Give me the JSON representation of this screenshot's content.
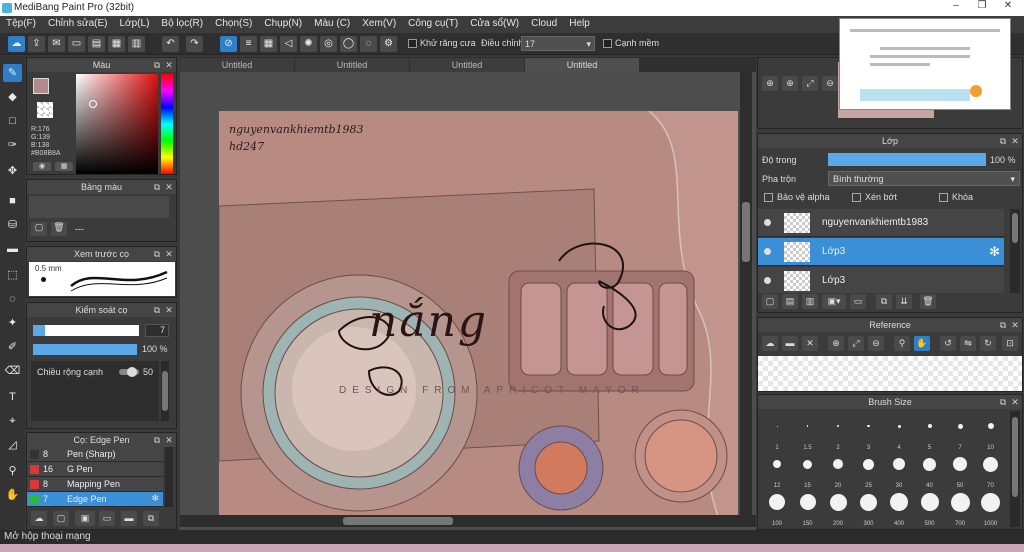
{
  "window": {
    "title": "MediBang Paint Pro (32bit)"
  },
  "menu": [
    "Tệp(F)",
    "Chỉnh sửa(E)",
    "Lớp(L)",
    "Bộ lọc(R)",
    "Chọn(S)",
    "Chụp(N)",
    "Màu (C)",
    "Xem(V)",
    "Công cụ(T)",
    "Cửa sổ(W)",
    "Cloud",
    "Help"
  ],
  "toolbar": {
    "antialias_label": "Khử răng cưa",
    "correction_label": "Điều chỉnh",
    "correction_value": "17",
    "sharp_label": "Cạnh mềm"
  },
  "doc_tabs": [
    "Untitled",
    "Untitled",
    "Untitled",
    "Untitled"
  ],
  "color_panel": {
    "title": "Màu",
    "r": "R:176",
    "g": "G:139",
    "b": "B:138",
    "hex": "#B08B8A",
    "current_color": "#b08b8a"
  },
  "palette_panel": {
    "title": "Bảng màu",
    "value": "---"
  },
  "preview_panel": {
    "title": "Xem trước cọ",
    "size": "0.5 mm"
  },
  "brush_control": {
    "title": "Kiểm soát cọ",
    "size": "7",
    "opacity": "100 %",
    "opacity_fraction": 1.0,
    "width_label": "Chiều rộng cạnh",
    "width_value": "50"
  },
  "brush_list": {
    "title": "Cọ: Edge Pen",
    "items": [
      {
        "size": "8",
        "name": "Pen (Sharp)",
        "color": "#333333"
      },
      {
        "size": "16",
        "name": "G Pen",
        "color": "#d83a3a"
      },
      {
        "size": "8",
        "name": "Mapping Pen",
        "color": "#d83a3a"
      },
      {
        "size": "7",
        "name": "Edge Pen",
        "color": "#2fb83a"
      }
    ]
  },
  "canvas": {
    "credit_line1": "nguyenvankhiemtb1983",
    "credit_line2": "hd247",
    "lettering": "nắng",
    "watermark": "DESIGN FROM APRICOT MAYOR"
  },
  "layer_panel": {
    "title": "Lớp",
    "opacity_label": "Độ trong",
    "opacity_value": "100 %",
    "opacity_fraction": 1.0,
    "blend_label": "Pha trộn",
    "blend_value": "Bình thường",
    "protect_alpha": "Bảo vệ alpha",
    "clipping": "Xén bớt",
    "lock": "Khóa",
    "layers": [
      {
        "name": "nguyenvankhiemtb1983",
        "active": false
      },
      {
        "name": "Lớp3",
        "active": true
      },
      {
        "name": "Lớp3",
        "active": false
      }
    ]
  },
  "reference_panel": {
    "title": "Reference"
  },
  "brush_size_panel": {
    "title": "Brush Size",
    "sizes": [
      "1",
      "1.5",
      "2",
      "3",
      "4",
      "5",
      "7",
      "10",
      "12",
      "15",
      "20",
      "25",
      "30",
      "40",
      "50",
      "70",
      "100",
      "150",
      "200",
      "300",
      "400",
      "500",
      "700",
      "1000"
    ]
  },
  "status": {
    "text": "Mở hộp thoại mạng"
  }
}
